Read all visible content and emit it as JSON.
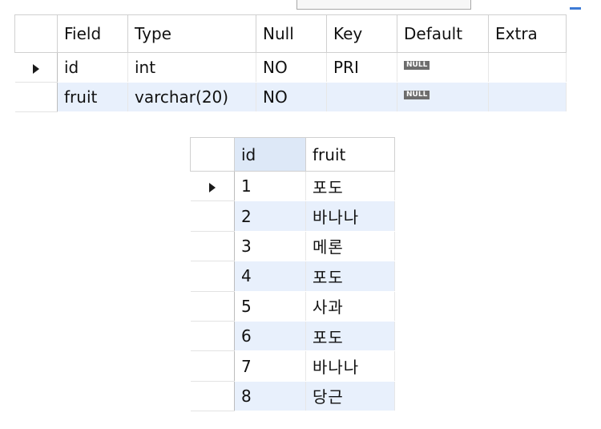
{
  "schema_grid": {
    "columns": [
      "Field",
      "Type",
      "Null",
      "Key",
      "Default",
      "Extra"
    ],
    "rows": [
      {
        "field": "id",
        "type": "int",
        "null": "NO",
        "key": "PRI",
        "default": "NULL",
        "extra": ""
      },
      {
        "field": "fruit",
        "type": "varchar(20)",
        "null": "NO",
        "key": "",
        "default": "NULL",
        "extra": ""
      }
    ]
  },
  "result_grid": {
    "columns": [
      "id",
      "fruit"
    ],
    "rows": [
      {
        "id": "1",
        "fruit": "포도"
      },
      {
        "id": "2",
        "fruit": "바나나"
      },
      {
        "id": "3",
        "fruit": "메론"
      },
      {
        "id": "4",
        "fruit": "포도"
      },
      {
        "id": "5",
        "fruit": "사과"
      },
      {
        "id": "6",
        "fruit": "포도"
      },
      {
        "id": "7",
        "fruit": "바나나"
      },
      {
        "id": "8",
        "fruit": "당근"
      }
    ]
  },
  "icons": {
    "current_row": "current-row-arrow-icon"
  },
  "colors": {
    "alt_row": "#e8f0fc",
    "sorted_header": "#dde8f7",
    "null_badge": "#6d6d6d"
  }
}
